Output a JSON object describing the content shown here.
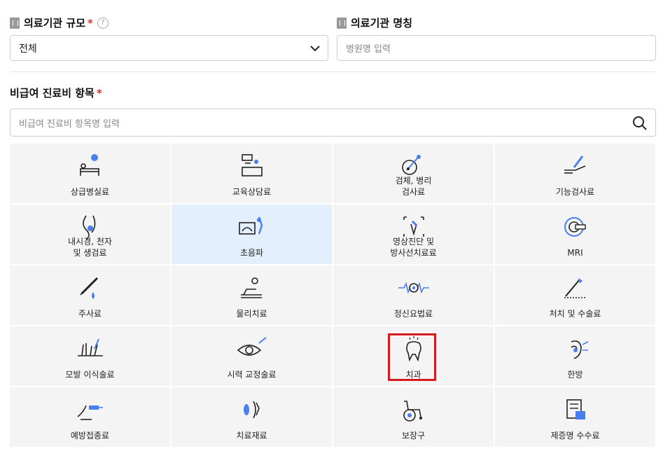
{
  "institution_size": {
    "label": "의료기관 규모",
    "required_mark": "*",
    "help_mark": "?",
    "selected": "전체"
  },
  "institution_name": {
    "label": "의료기관 명칭",
    "placeholder": "병원명 입력"
  },
  "item_section": {
    "label": "비급여 진료비 항목",
    "required_mark": "*",
    "search_placeholder": "비급여 진료비 항목명 입력"
  },
  "categories": [
    {
      "label": "상급병실료",
      "icon": "hospital-bed-icon"
    },
    {
      "label": "교육상담료",
      "icon": "counseling-icon"
    },
    {
      "label": "검체, 병리\n검사료",
      "icon": "specimen-pathology-icon"
    },
    {
      "label": "기능검사료",
      "icon": "function-test-icon"
    },
    {
      "label": "내시경, 천자\n및 생검료",
      "icon": "endoscopy-icon"
    },
    {
      "label": "초음파",
      "icon": "ultrasound-icon"
    },
    {
      "label": "영상진단 및\n방사선치료료",
      "icon": "imaging-radiation-icon"
    },
    {
      "label": "MRI",
      "icon": "mri-icon"
    },
    {
      "label": "주사료",
      "icon": "syringe-icon"
    },
    {
      "label": "물리치료",
      "icon": "physical-therapy-icon"
    },
    {
      "label": "정신요법료",
      "icon": "psychotherapy-icon"
    },
    {
      "label": "처치 및 수술료",
      "icon": "surgery-icon"
    },
    {
      "label": "모발 이식술료",
      "icon": "hair-transplant-icon"
    },
    {
      "label": "시력 교정술료",
      "icon": "vision-correction-icon"
    },
    {
      "label": "치과",
      "icon": "tooth-icon"
    },
    {
      "label": "한방",
      "icon": "oriental-medicine-icon"
    },
    {
      "label": "예방접종료",
      "icon": "vaccination-icon"
    },
    {
      "label": "치료재료",
      "icon": "treatment-material-icon"
    },
    {
      "label": "보장구",
      "icon": "wheelchair-icon"
    },
    {
      "label": "제증명 수수료",
      "icon": "certificate-fee-icon"
    }
  ],
  "selected_category": "초음파",
  "highlighted_category": "치과",
  "colors": {
    "accent": "#4a7ff0",
    "selected_bg": "#e4effd",
    "highlight_border": "#d71920",
    "required": "#e0312c"
  }
}
